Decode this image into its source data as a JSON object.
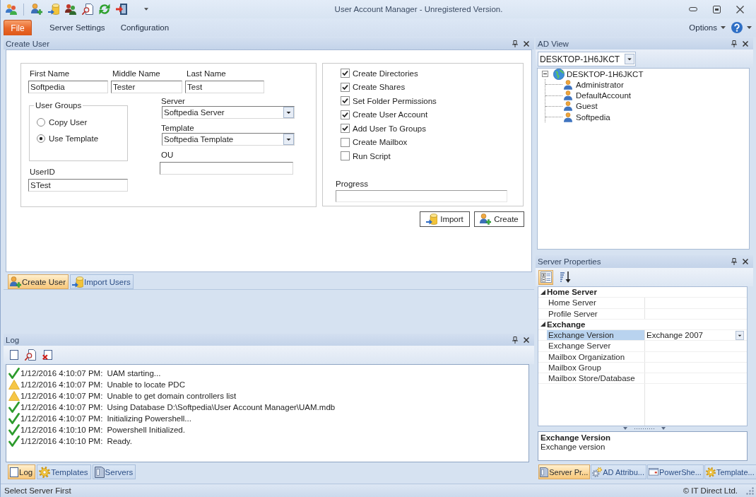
{
  "window": {
    "title": "User Account Manager - Unregistered Version."
  },
  "menu": [
    {
      "label": "File",
      "kind": "application"
    },
    {
      "label": "Server Settings",
      "kind": "item"
    },
    {
      "label": "Configuration",
      "kind": "item"
    }
  ],
  "options_menu": {
    "label": "Options"
  },
  "create_panel": {
    "title": "Create User",
    "name_fields": [
      {
        "label": "First Name",
        "value": "Softpedia"
      },
      {
        "label": "Middle Name",
        "value": "Tester"
      },
      {
        "label": "Last Name",
        "value": "Test"
      }
    ],
    "user_groups": {
      "title": "User Groups",
      "options": [
        {
          "label": "Copy User",
          "selected": false
        },
        {
          "label": "Use Template",
          "selected": true
        }
      ]
    },
    "user_id": {
      "label": "UserID",
      "value": "STest"
    },
    "server_fields": [
      {
        "label": "Server",
        "value": "Softpedia Server",
        "kind": "dropdown"
      },
      {
        "label": "Template",
        "value": "Softpedia Template",
        "kind": "dropdown"
      },
      {
        "label": "OU",
        "kind": "text"
      }
    ],
    "actions": [
      {
        "label": "Create Directories",
        "checked": true
      },
      {
        "label": "Create Shares",
        "checked": true
      },
      {
        "label": "Set Folder Permissions",
        "checked": true
      },
      {
        "label": "Create User Account",
        "checked": true
      },
      {
        "label": "Add User To Groups",
        "checked": true
      },
      {
        "label": "Create Mailbox",
        "checked": false
      },
      {
        "label": "Run Script",
        "checked": false
      }
    ],
    "progress": {
      "label": "Progress",
      "level": 0
    },
    "buttons": [
      {
        "label": "Import",
        "kind": "import"
      },
      {
        "label": "Create",
        "kind": "adduser"
      }
    ],
    "tabs": [
      {
        "label": "Create User",
        "kind": "adduser",
        "selected": true
      },
      {
        "label": "Import Users",
        "kind": "import",
        "selected": false
      }
    ]
  },
  "log_panel": {
    "title": "Log",
    "entries": [
      {
        "kind": "success",
        "time": "1/12/2016 4:10:07 PM:",
        "message": "UAM starting..."
      },
      {
        "kind": "warning",
        "time": "1/12/2016 4:10:07 PM:",
        "message": "Unable to locate PDC"
      },
      {
        "kind": "warning",
        "time": "1/12/2016 4:10:07 PM:",
        "message": "Unable to get domain controllers list"
      },
      {
        "kind": "success",
        "time": "1/12/2016 4:10:07 PM:",
        "message": "Using Database D:\\Softpedia\\User Account Manager\\UAM.mdb"
      },
      {
        "kind": "success",
        "time": "1/12/2016 4:10:07 PM:",
        "message": "Initializing Powershell..."
      },
      {
        "kind": "success",
        "time": "1/12/2016 4:10:10 PM:",
        "message": "Powershell Initialized."
      },
      {
        "kind": "success",
        "time": "1/12/2016 4:10:10 PM:",
        "message": "Ready."
      }
    ],
    "tabs": [
      {
        "label": "Log",
        "kind": "page",
        "selected": true
      },
      {
        "label": "Templates",
        "kind": "gear",
        "selected": false
      },
      {
        "label": "Servers",
        "kind": "server",
        "selected": false
      }
    ]
  },
  "ad_view": {
    "title": "AD View",
    "domain": "DESKTOP-1H6JKCT",
    "tree": [
      {
        "label": "DESKTOP-1H6JKCT",
        "kind": "domain",
        "expanded": true,
        "children": [
          {
            "label": "Administrator",
            "kind": "user"
          },
          {
            "label": "DefaultAccount",
            "kind": "user"
          },
          {
            "label": "Guest",
            "kind": "user"
          },
          {
            "label": "Softpedia",
            "kind": "user"
          }
        ]
      }
    ]
  },
  "server_properties": {
    "title": "Server Properties",
    "view_modes": [
      {
        "kind": "categorized",
        "selected": true
      },
      {
        "kind": "alphabetical",
        "selected": false
      }
    ],
    "categories": [
      {
        "name": "Home Server",
        "expanded": true,
        "properties": [
          {
            "name": "Home Server",
            "selected": false
          },
          {
            "name": "Profile Server",
            "selected": false
          }
        ]
      },
      {
        "name": "Exchange",
        "expanded": true,
        "properties": [
          {
            "name": "Exchange Version",
            "value": "Exchange 2007",
            "selected": true
          },
          {
            "name": "Exchange Server",
            "selected": false
          },
          {
            "name": "Mailbox Organization",
            "selected": false
          },
          {
            "name": "Mailbox Group",
            "selected": false
          },
          {
            "name": "Mailbox Store/Database",
            "selected": false
          }
        ]
      }
    ],
    "description": {
      "title": "Exchange Version",
      "text": "Exchange version"
    },
    "tabs": [
      {
        "label": "Server Pr...",
        "kind": "server",
        "selected": true
      },
      {
        "label": "AD Attribu...",
        "kind": "gears",
        "selected": false
      },
      {
        "label": "PowerShe...",
        "kind": "window",
        "selected": false
      },
      {
        "label": "Template...",
        "kind": "gear",
        "selected": false
      }
    ]
  },
  "status_bar": {
    "message": "Select Server First",
    "copyright": "© IT Direct Ltd."
  }
}
